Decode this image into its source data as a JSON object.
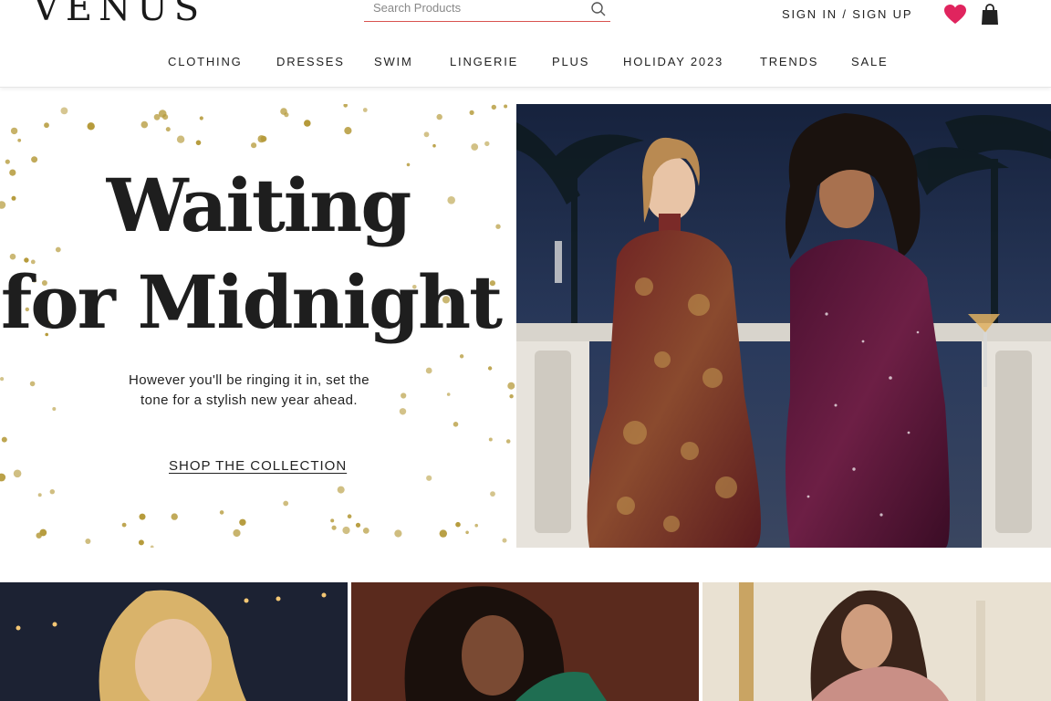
{
  "brand": {
    "logo": "VENUS"
  },
  "search": {
    "placeholder": "Search Products"
  },
  "account": {
    "signin_label": "SIGN IN / SIGN UP"
  },
  "nav": {
    "items": [
      {
        "label": "CLOTHING"
      },
      {
        "label": "DRESSES"
      },
      {
        "label": "SWIM"
      },
      {
        "label": "LINGERIE"
      },
      {
        "label": "PLUS"
      },
      {
        "label": "HOLIDAY 2023"
      },
      {
        "label": "TRENDS"
      },
      {
        "label": "SALE"
      }
    ]
  },
  "hero": {
    "title_line1": "Waiting",
    "title_line2": "for Midnight",
    "subtitle": "However you'll be ringing it in, set the tone for a stylish new year ahead.",
    "cta_label": "SHOP THE COLLECTION"
  },
  "icons": {
    "search": "search-icon",
    "wishlist": "heart-icon",
    "cart": "shopping-bag-icon"
  },
  "colors": {
    "accent_heart": "#e0245e",
    "search_underline": "#d9534f",
    "confetti_gold": "#b59a3a",
    "text": "#222222"
  }
}
